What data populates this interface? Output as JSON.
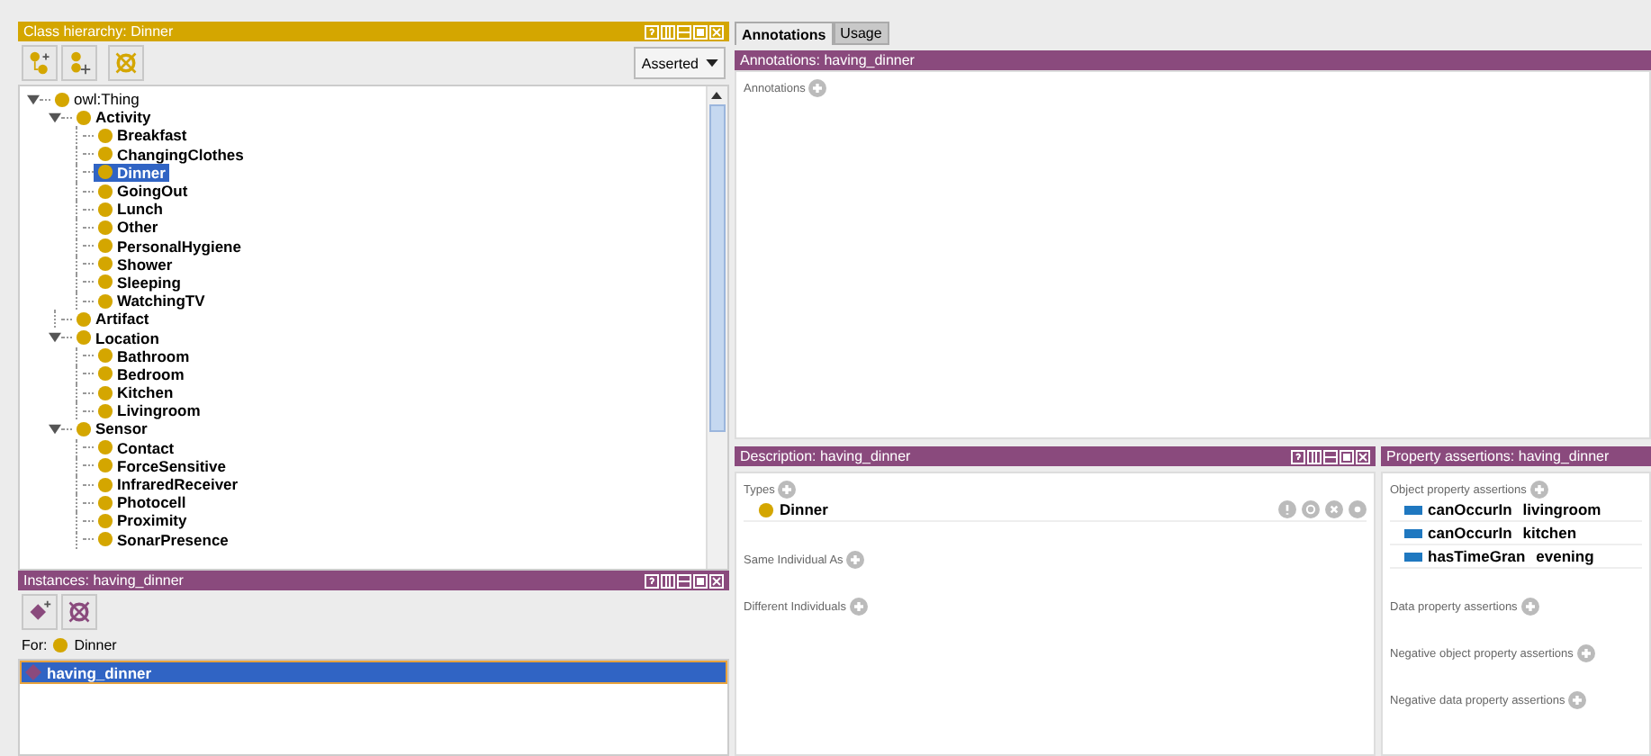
{
  "class_hierarchy": {
    "title": "Class hierarchy: Dinner",
    "view_selector": "Asserted",
    "tree": [
      {
        "label": "owl:Thing",
        "kind": "builtin",
        "selected": false,
        "expanded": true,
        "children": [
          {
            "label": "Activity",
            "kind": "class",
            "selected": false,
            "expanded": true,
            "children": [
              {
                "label": "Breakfast",
                "kind": "class",
                "selected": false
              },
              {
                "label": "ChangingClothes",
                "kind": "class",
                "selected": false
              },
              {
                "label": "Dinner",
                "kind": "class",
                "selected": true
              },
              {
                "label": "GoingOut",
                "kind": "class",
                "selected": false
              },
              {
                "label": "Lunch",
                "kind": "class",
                "selected": false
              },
              {
                "label": "Other",
                "kind": "class",
                "selected": false
              },
              {
                "label": "PersonalHygiene",
                "kind": "class",
                "selected": false
              },
              {
                "label": "Shower",
                "kind": "class",
                "selected": false
              },
              {
                "label": "Sleeping",
                "kind": "class",
                "selected": false
              },
              {
                "label": "WatchingTV",
                "kind": "class",
                "selected": false
              }
            ]
          },
          {
            "label": "Artifact",
            "kind": "class",
            "selected": false
          },
          {
            "label": "Location",
            "kind": "class",
            "selected": false,
            "expanded": true,
            "children": [
              {
                "label": "Bathroom",
                "kind": "class",
                "selected": false
              },
              {
                "label": "Bedroom",
                "kind": "class",
                "selected": false
              },
              {
                "label": "Kitchen",
                "kind": "class",
                "selected": false
              },
              {
                "label": "Livingroom",
                "kind": "class",
                "selected": false
              }
            ]
          },
          {
            "label": "Sensor",
            "kind": "class",
            "selected": false,
            "expanded": true,
            "children": [
              {
                "label": "Contact",
                "kind": "class",
                "selected": false
              },
              {
                "label": "ForceSensitive",
                "kind": "class",
                "selected": false
              },
              {
                "label": "InfraredReceiver",
                "kind": "class",
                "selected": false
              },
              {
                "label": "Photocell",
                "kind": "class",
                "selected": false
              },
              {
                "label": "Proximity",
                "kind": "class",
                "selected": false
              },
              {
                "label": "SonarPresence",
                "kind": "class",
                "selected": false
              }
            ]
          }
        ]
      }
    ]
  },
  "instances": {
    "title": "Instances: having_dinner",
    "for_label": "For:",
    "for_class": "Dinner",
    "items": [
      {
        "label": "having_dinner",
        "selected": true
      }
    ]
  },
  "tabs": [
    {
      "label": "Annotations",
      "selected": true
    },
    {
      "label": "Usage",
      "selected": false
    }
  ],
  "annotations": {
    "title": "Annotations: having_dinner",
    "section": "Annotations"
  },
  "description": {
    "title": "Description: having_dinner",
    "sections": [
      {
        "label": "Types",
        "entries": [
          {
            "label": "Dinner"
          }
        ]
      },
      {
        "label": "Same Individual As"
      },
      {
        "label": "Different Individuals"
      }
    ]
  },
  "property_assertions": {
    "title": "Property assertions: having_dinner",
    "sections": [
      {
        "label": "Object property assertions",
        "entries": [
          {
            "property": "canOccurIn",
            "value": "livingroom"
          },
          {
            "property": "canOccurIn",
            "value": "kitchen"
          },
          {
            "property": "hasTimeGran",
            "value": "evening"
          }
        ]
      },
      {
        "label": "Data property assertions"
      },
      {
        "label": "Negative object property assertions"
      },
      {
        "label": "Negative data property assertions"
      }
    ]
  }
}
